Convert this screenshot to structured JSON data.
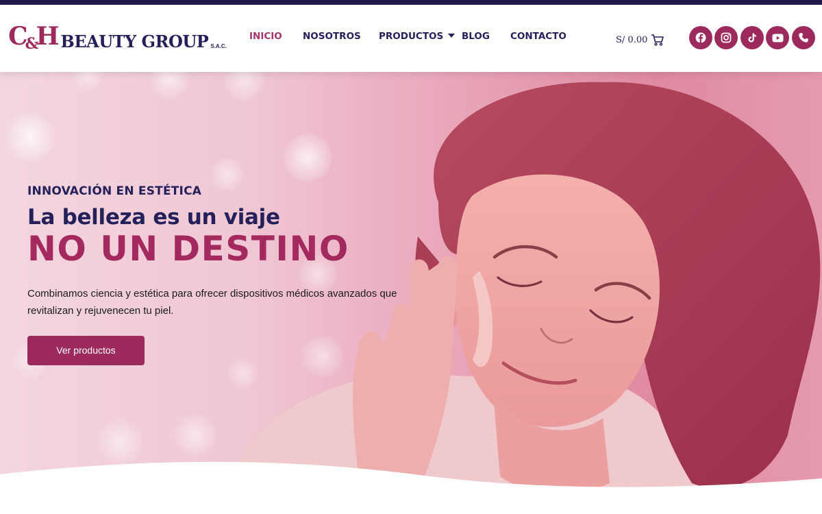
{
  "brand": {
    "logo_mark": "C&H",
    "logo_text": "BEAUTY GROUP",
    "logo_suffix": "S.A.C."
  },
  "colors": {
    "primary": "#9c2a5c",
    "navy": "#24205a",
    "top_strip": "#1f1b4b",
    "active_nav": "#a4346a"
  },
  "nav": {
    "items": [
      {
        "label": "INICIO",
        "active": true
      },
      {
        "label": "NOSOTROS",
        "active": false
      },
      {
        "label": "PRODUCTOS",
        "active": false,
        "has_dropdown": true
      },
      {
        "label": "BLOG",
        "active": false
      },
      {
        "label": "CONTACTO",
        "active": false
      }
    ]
  },
  "cart": {
    "amount": "S/ 0.00",
    "icon": "cart-icon"
  },
  "socials": [
    {
      "name": "facebook",
      "icon": "facebook-icon"
    },
    {
      "name": "instagram",
      "icon": "instagram-icon"
    },
    {
      "name": "tiktok",
      "icon": "tiktok-icon"
    },
    {
      "name": "youtube",
      "icon": "youtube-icon"
    },
    {
      "name": "phone",
      "icon": "phone-icon"
    }
  ],
  "hero": {
    "eyebrow": "INNOVACIÓN EN ESTÉTICA",
    "headline": "La belleza es un viaje",
    "headline_accent": "NO UN DESTINO",
    "description": "Combinamos ciencia y estética para ofrecer dispositivos médicos avanzados que revitalizan y rejuvenecen tu piel.",
    "cta_label": "Ver productos"
  }
}
